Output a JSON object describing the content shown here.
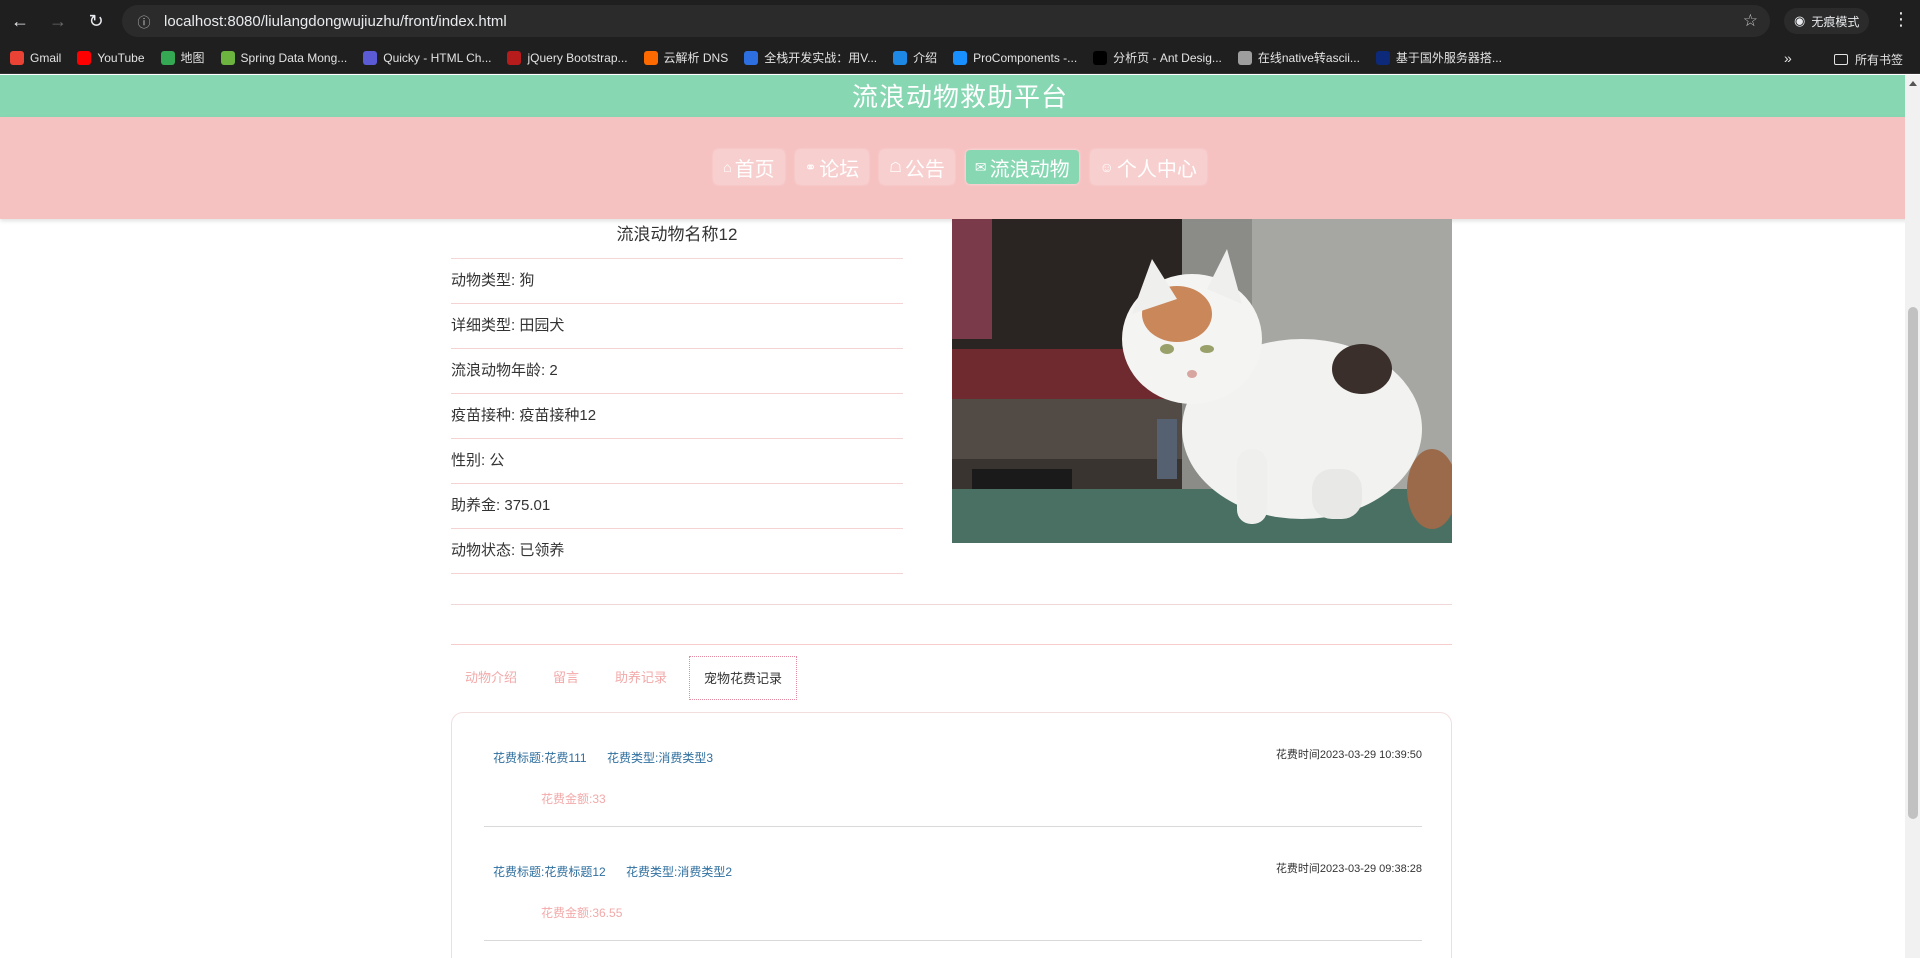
{
  "browser": {
    "url": "localhost:8080/liulangdongwujiuzhu/front/index.html",
    "incognito_label": "无痕模式",
    "bookmarks": [
      {
        "label": "Gmail",
        "icon": "gmail-icon",
        "color": "#ea4335"
      },
      {
        "label": "YouTube",
        "icon": "youtube-icon",
        "color": "#ff0000"
      },
      {
        "label": "地图",
        "icon": "maps-icon",
        "color": "#34a853"
      },
      {
        "label": "Spring Data Mong...",
        "icon": "spring-icon",
        "color": "#6db33f"
      },
      {
        "label": "Quicky - HTML Ch...",
        "icon": "quicky-icon",
        "color": "#5b5bd6"
      },
      {
        "label": "jQuery Bootstrap...",
        "icon": "jquery-icon",
        "color": "#b71c1c"
      },
      {
        "label": "云解析 DNS",
        "icon": "aliyun-icon",
        "color": "#ff6a00"
      },
      {
        "label": "全栈开发实战：用V...",
        "icon": "m-icon",
        "color": "#2d6fe0"
      },
      {
        "label": "介绍",
        "icon": "globe-icon",
        "color": "#1e88e5"
      },
      {
        "label": "ProComponents -...",
        "icon": "procomponents-icon",
        "color": "#1890ff"
      },
      {
        "label": "分析页 - Ant Desig...",
        "icon": "pro-icon",
        "color": "#000000"
      },
      {
        "label": "在线native转ascii...",
        "icon": "web-icon",
        "color": "#9e9e9e"
      },
      {
        "label": "基于国外服务器搭...",
        "icon": "flag-icon",
        "color": "#0d2a7a"
      }
    ],
    "all_bookmarks_label": "所有书签"
  },
  "site": {
    "title": "流浪动物救助平台",
    "nav": [
      {
        "label": "首页",
        "icon": "home-icon",
        "active": false
      },
      {
        "label": "论坛",
        "icon": "forum-icon",
        "active": false
      },
      {
        "label": "公告",
        "icon": "notice-icon",
        "active": false
      },
      {
        "label": "流浪动物",
        "icon": "mail-icon",
        "active": true
      },
      {
        "label": "个人中心",
        "icon": "user-icon",
        "active": false
      }
    ]
  },
  "animal": {
    "name": "流浪动物名称12",
    "fields": [
      {
        "label": "动物类型",
        "value": "狗"
      },
      {
        "label": "详细类型",
        "value": "田园犬"
      },
      {
        "label": "流浪动物年龄",
        "value": "2"
      },
      {
        "label": "疫苗接种",
        "value": "疫苗接种12"
      },
      {
        "label": "性别",
        "value": "公"
      },
      {
        "label": "助养金",
        "value": "375.01"
      },
      {
        "label": "动物状态",
        "value": "已领养"
      }
    ]
  },
  "tabs": [
    {
      "label": "动物介绍",
      "active": false
    },
    {
      "label": "留言",
      "active": false
    },
    {
      "label": "助养记录",
      "active": false
    },
    {
      "label": "宠物花费记录",
      "active": true
    }
  ],
  "records": [
    {
      "title": "花费标题:花费111",
      "type": "花费类型:消费类型3",
      "amount": "花费金额:33",
      "time": "花费时间2023-03-29 10:39:50"
    },
    {
      "title": "花费标题:花费标题12",
      "type": "花费类型:消费类型2",
      "amount": "花费金额:36.55",
      "time": "花费时间2023-03-29 09:38:28"
    }
  ],
  "colors": {
    "header_green": "#88d7b3",
    "nav_pink": "#f6c1c1",
    "tab_pink": "#f2a9a9",
    "record_blue": "#2f6f9f"
  }
}
